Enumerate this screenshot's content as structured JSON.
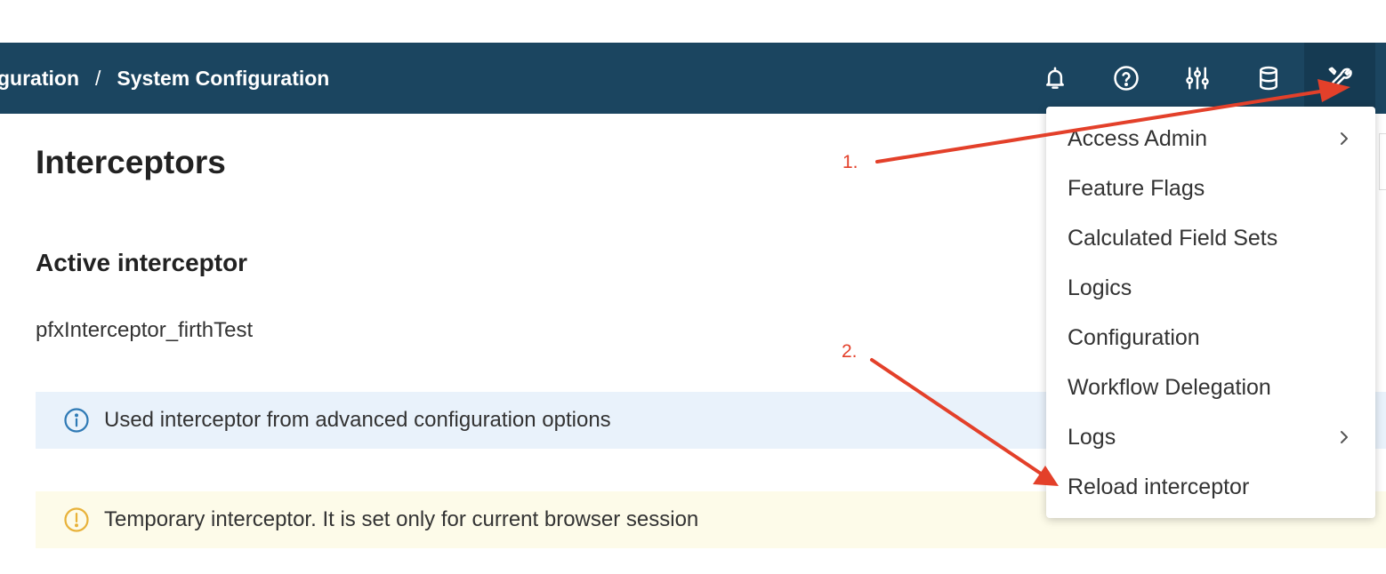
{
  "header": {
    "breadcrumb_parent": "guration",
    "breadcrumb_separator": "/",
    "breadcrumb_current": "System Configuration",
    "icons": [
      "bell-icon",
      "help-icon",
      "sliders-icon",
      "database-icon",
      "wrench-icon"
    ],
    "background_color": "#1b4560"
  },
  "page": {
    "title": "Interceptors",
    "section_title": "Active interceptor",
    "interceptor_name": "pfxInterceptor_firthTest"
  },
  "alerts": {
    "info_text": "Used interceptor from advanced configuration options",
    "warning_text": "Temporary interceptor. It is set only for current browser session",
    "info_color": "#2f7ab5",
    "warning_color": "#e8b23a"
  },
  "menu": {
    "items": [
      {
        "label": "Access Admin",
        "has_submenu": true
      },
      {
        "label": "Feature Flags",
        "has_submenu": false
      },
      {
        "label": "Calculated Field Sets",
        "has_submenu": false
      },
      {
        "label": "Logics",
        "has_submenu": false
      },
      {
        "label": "Configuration",
        "has_submenu": false
      },
      {
        "label": "Workflow Delegation",
        "has_submenu": false
      },
      {
        "label": "Logs",
        "has_submenu": true
      },
      {
        "label": "Reload interceptor",
        "has_submenu": false
      }
    ]
  },
  "annotations": {
    "step1": "1.",
    "step2": "2.",
    "arrow_color": "#e3402a"
  }
}
